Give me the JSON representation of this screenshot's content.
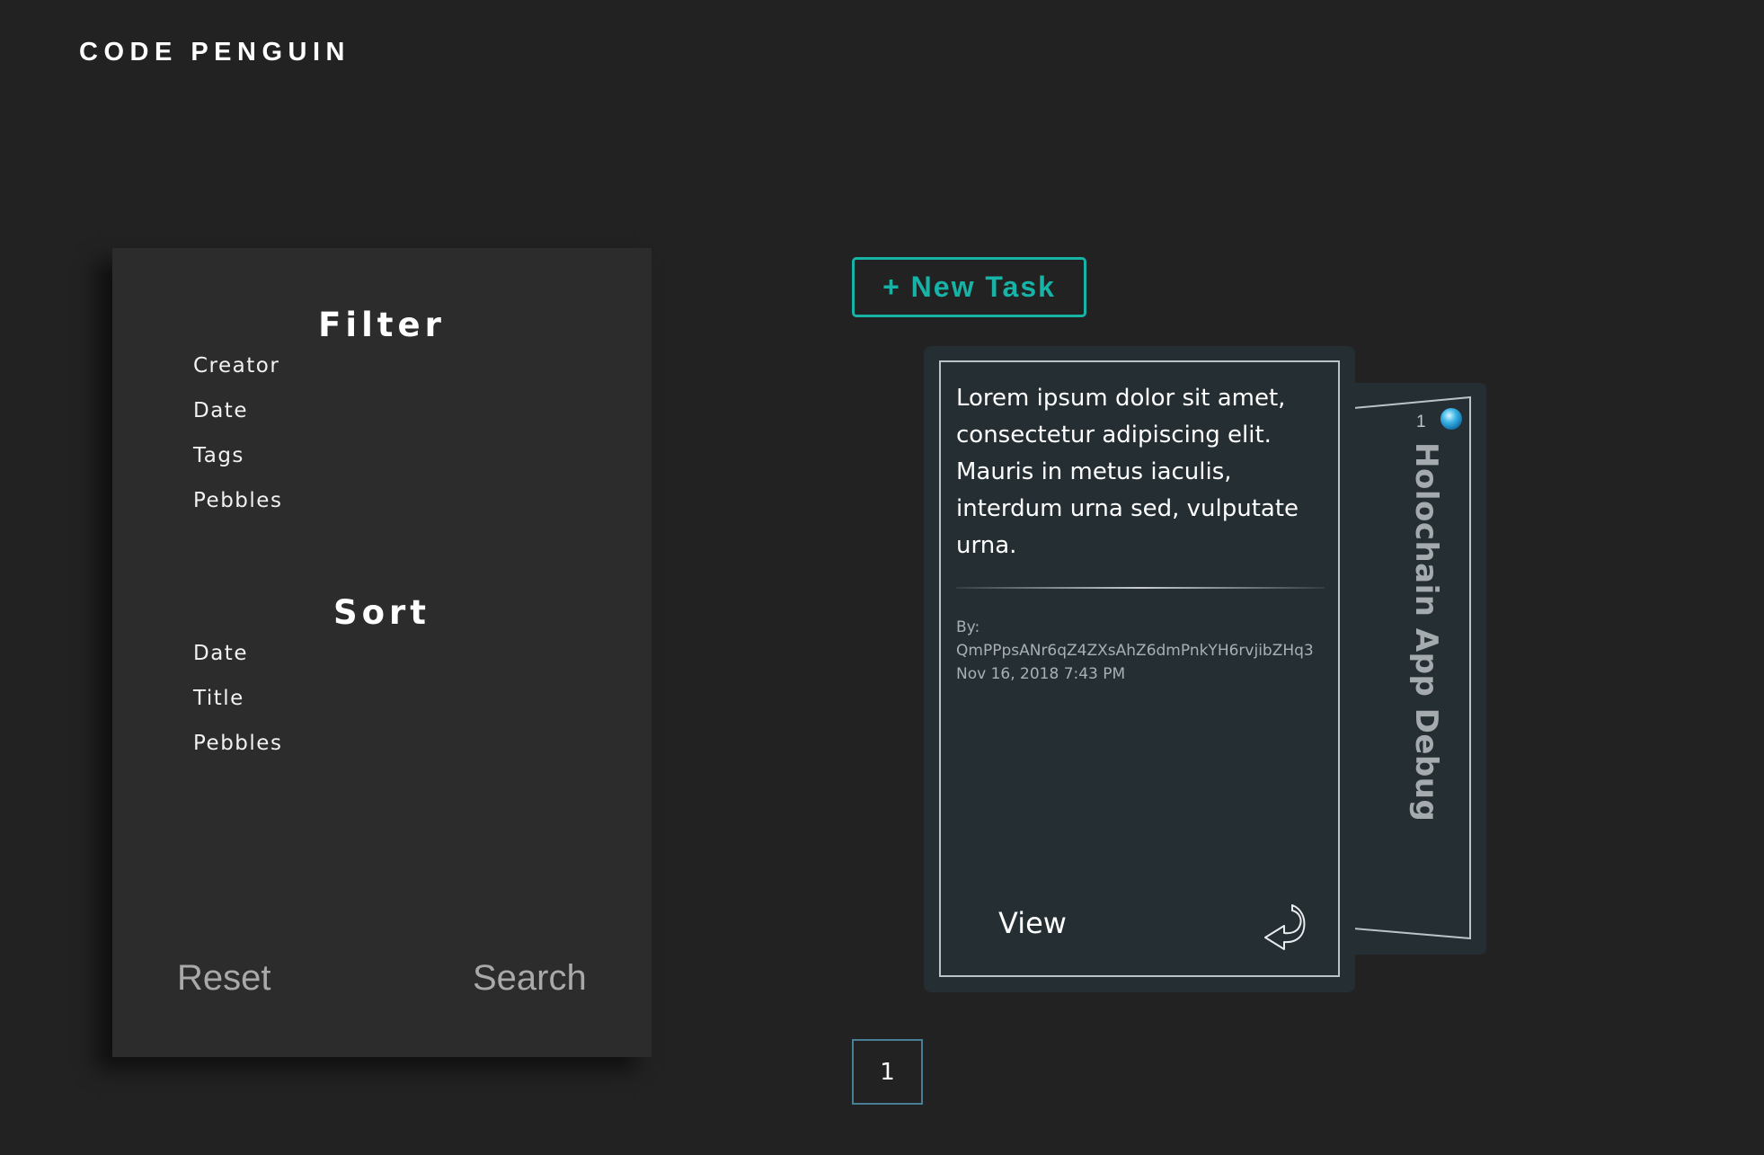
{
  "brand": {
    "title": "CODE PENGUIN"
  },
  "filter_panel": {
    "filter_heading": "Filter",
    "filter_options": [
      "Creator",
      "Date",
      "Tags",
      "Pebbles"
    ],
    "sort_heading": "Sort",
    "sort_options": [
      "Date",
      "Title",
      "Pebbles"
    ],
    "reset_label": "Reset",
    "search_label": "Search"
  },
  "toolbar": {
    "new_task_label": "+ New Task"
  },
  "task_card": {
    "body": "Lorem ipsum dolor sit amet, consectetur adipiscing elit. Mauris in metus iaculis, interdum urna sed, vulputate urna.",
    "by_label": "By:",
    "creator_hash": "QmPPpsANr6qZ4ZXsAhZ6dmPnkYH6rvjibZHq3",
    "timestamp": "Nov 16, 2018 7:43 PM",
    "view_label": "View",
    "side_count": "1",
    "side_title": "Holochain App Debug",
    "pebble_icon": "pebble-gem-icon",
    "flip_icon": "flip-arrow-icon"
  },
  "pagination": {
    "current_page": "1"
  },
  "colors": {
    "background": "#222222",
    "panel": "#2c2c2c",
    "card": "#242e33",
    "accent": "#17b3a6",
    "pagination_border": "#4a7e96"
  }
}
